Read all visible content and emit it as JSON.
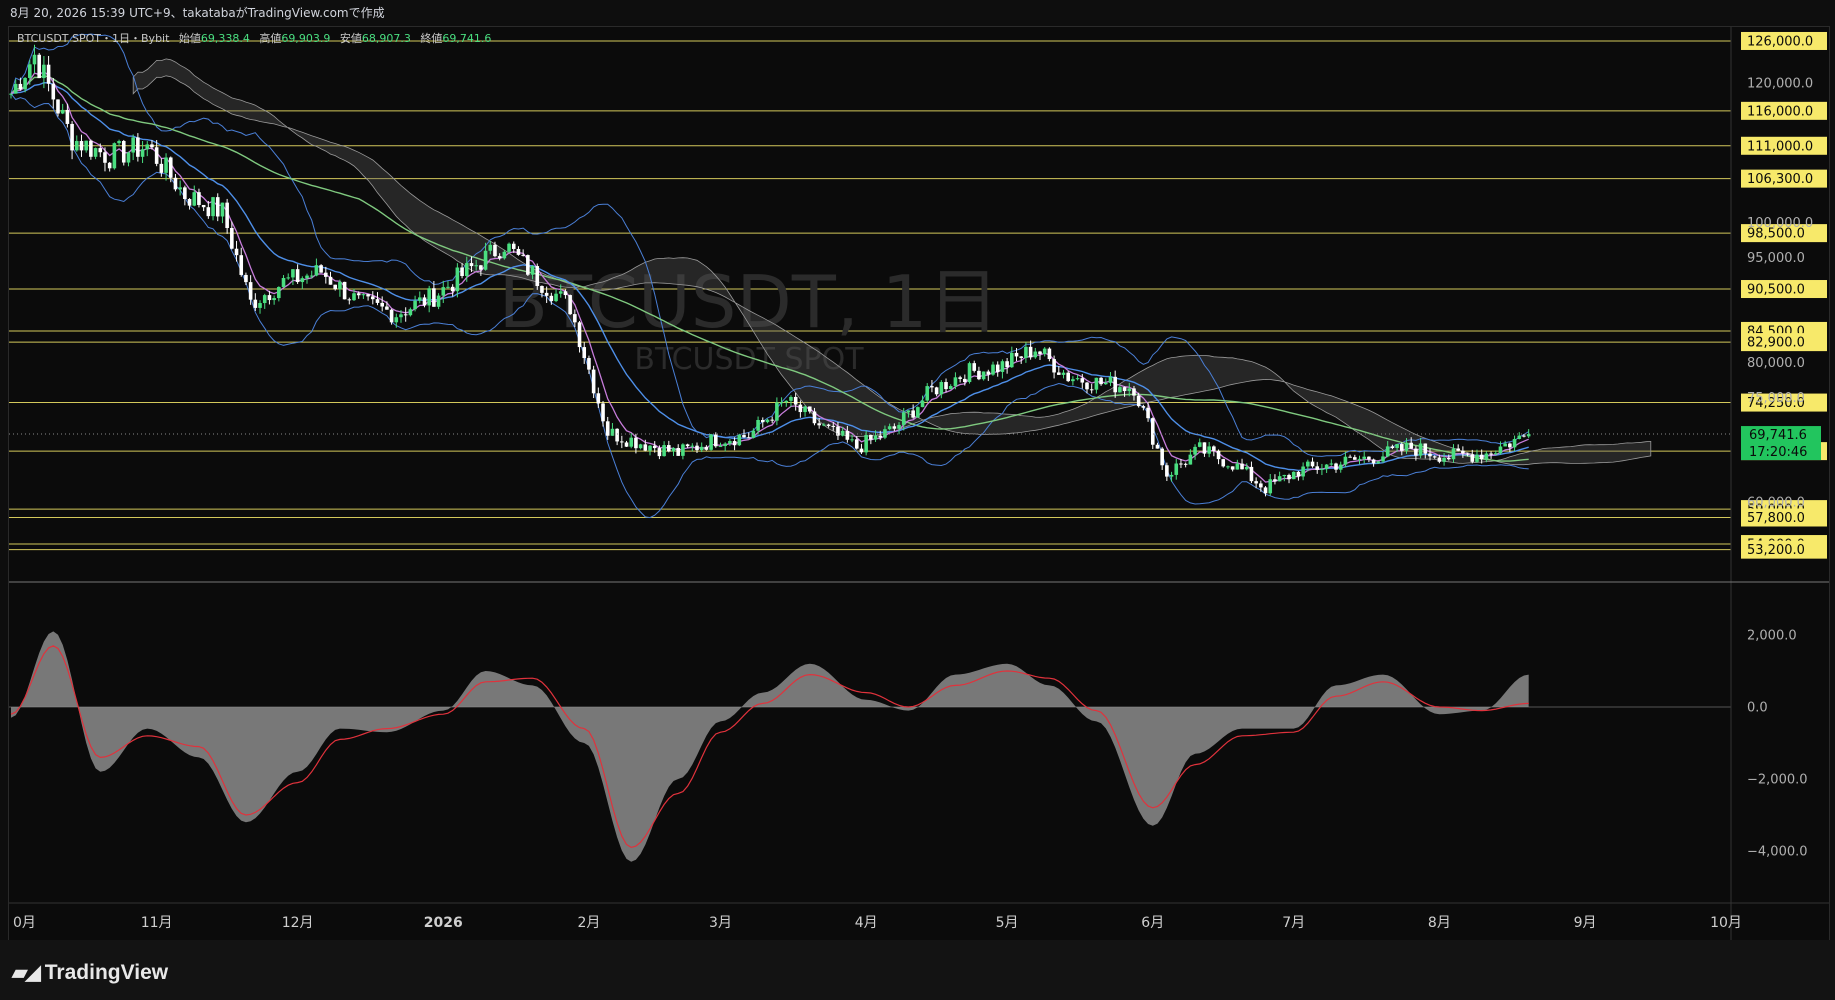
{
  "header": {
    "caption": "8月 20, 2026 15:39 UTC+9、takatabaがTradingView.comで作成"
  },
  "legend": {
    "symbol": "BTCUSDT SPOT・1日・Bybit",
    "open_label": "始値",
    "open": "69,338.4",
    "high_label": "高値",
    "high": "69,903.9",
    "low_label": "安値",
    "low": "68,907.3",
    "close_label": "終値",
    "close": "69,741.6"
  },
  "watermark": {
    "title": "BTCUSDT, 1日",
    "subtitle": "BTCUSDT SPOT"
  },
  "price_tag": {
    "price": "69,741.6",
    "countdown": "17:20:46"
  },
  "colors": {
    "up": "#4ade80",
    "down": "#ffffff",
    "level": "#f7e96a",
    "bb": "#4a7fd6",
    "ema_fast": "#c77ddb",
    "ema_mid": "#4e8fe8",
    "ema_slow": "#7fc97f",
    "cloud": "#5a5a5a",
    "macd_signal": "#e0323c",
    "histogram": "#8c8c8c"
  },
  "footer": {
    "brand": "TradingView"
  },
  "chart_data": [
    {
      "type": "candlestick",
      "title": "BTCUSDT, 1日",
      "ylim": [
        50000,
        128000
      ],
      "x_ticks": [
        "0月",
        "11月",
        "12月",
        "2026",
        "2月",
        "3月",
        "4月",
        "5月",
        "6月",
        "7月",
        "8月",
        "9月",
        "10月"
      ],
      "y_ticks": [
        "120,000.0",
        "100,000.0",
        "95,000.0",
        "80,000.0",
        "75,000.0",
        "60,000.0"
      ],
      "horizontal_levels": [
        "126,000.0",
        "116,000.0",
        "111,000.0",
        "106,300.0",
        "98,500.0",
        "90,500.0",
        "84,500.0",
        "82,900.0",
        "74,250.0",
        "67,300.0",
        "59,000.0",
        "57,800.0",
        "54,000.0",
        "53,200.0"
      ],
      "last_price": 69741.6,
      "series": [
        {
          "name": "Close",
          "x": [
            "10/01",
            "10/06",
            "10/14",
            "10/22",
            "10/30",
            "11/07",
            "11/15",
            "11/21",
            "11/28",
            "12/06",
            "12/14",
            "12/22",
            "12/30",
            "01/07",
            "01/14",
            "01/21",
            "01/28",
            "02/05",
            "02/12",
            "02/20",
            "02/28",
            "03/07",
            "03/15",
            "03/22",
            "03/30",
            "04/07",
            "04/15",
            "04/22",
            "04/30",
            "05/07",
            "05/14",
            "05/21",
            "05/28",
            "06/04",
            "06/11",
            "06/18",
            "06/25",
            "07/02",
            "07/10",
            "07/18",
            "07/26",
            "08/03",
            "08/11",
            "08/20"
          ],
          "values": [
            118500,
            124000,
            112000,
            109500,
            111000,
            104000,
            101500,
            88500,
            91500,
            93000,
            88500,
            87000,
            89500,
            93500,
            97000,
            92000,
            88000,
            70000,
            68500,
            67000,
            69000,
            69500,
            74500,
            71000,
            67800,
            70500,
            76000,
            78500,
            79500,
            82000,
            78000,
            77000,
            76500,
            64000,
            67500,
            65500,
            62000,
            64500,
            65500,
            66500,
            67800,
            66500,
            67000,
            69741.6
          ]
        }
      ]
    },
    {
      "type": "area",
      "title": "MACD",
      "ylim": [
        -5000,
        3000
      ],
      "y_ticks": [
        "2,000.0",
        "0.0",
        "−2,000.0",
        "−4,000.0"
      ],
      "series": [
        {
          "name": "Histogram",
          "x": [
            "10/01",
            "10/10",
            "10/20",
            "10/30",
            "11/10",
            "11/20",
            "12/01",
            "12/10",
            "12/20",
            "01/01",
            "01/10",
            "01/20",
            "01/31",
            "02/10",
            "02/20",
            "03/01",
            "03/10",
            "03/20",
            "04/01",
            "04/10",
            "04/20",
            "05/01",
            "05/10",
            "05/20",
            "06/01",
            "06/10",
            "06/20",
            "07/01",
            "07/10",
            "07/20",
            "08/01",
            "08/10",
            "08/20"
          ],
          "values": [
            -300,
            2100,
            -1800,
            -600,
            -1400,
            -3200,
            -1800,
            -600,
            -700,
            -100,
            1000,
            600,
            -1000,
            -4300,
            -2000,
            -400,
            400,
            1200,
            200,
            -100,
            900,
            1200,
            600,
            -400,
            -3300,
            -1300,
            -600,
            -600,
            600,
            900,
            -200,
            -100,
            900
          ]
        },
        {
          "name": "Signal",
          "x": [
            "10/01",
            "10/10",
            "10/20",
            "10/30",
            "11/10",
            "11/20",
            "12/01",
            "12/10",
            "12/20",
            "01/01",
            "01/10",
            "01/20",
            "01/31",
            "02/10",
            "02/20",
            "03/01",
            "03/10",
            "03/20",
            "04/01",
            "04/10",
            "04/20",
            "05/01",
            "05/10",
            "05/20",
            "06/01",
            "06/10",
            "06/20",
            "07/01",
            "07/10",
            "07/20",
            "08/01",
            "08/10",
            "08/20"
          ],
          "values": [
            -200,
            1700,
            -1400,
            -800,
            -1100,
            -3000,
            -2100,
            -900,
            -600,
            -200,
            700,
            800,
            -600,
            -3900,
            -2400,
            -700,
            100,
            900,
            400,
            0,
            600,
            1000,
            800,
            -100,
            -2800,
            -1600,
            -800,
            -700,
            300,
            700,
            0,
            -100,
            100
          ]
        }
      ]
    }
  ]
}
